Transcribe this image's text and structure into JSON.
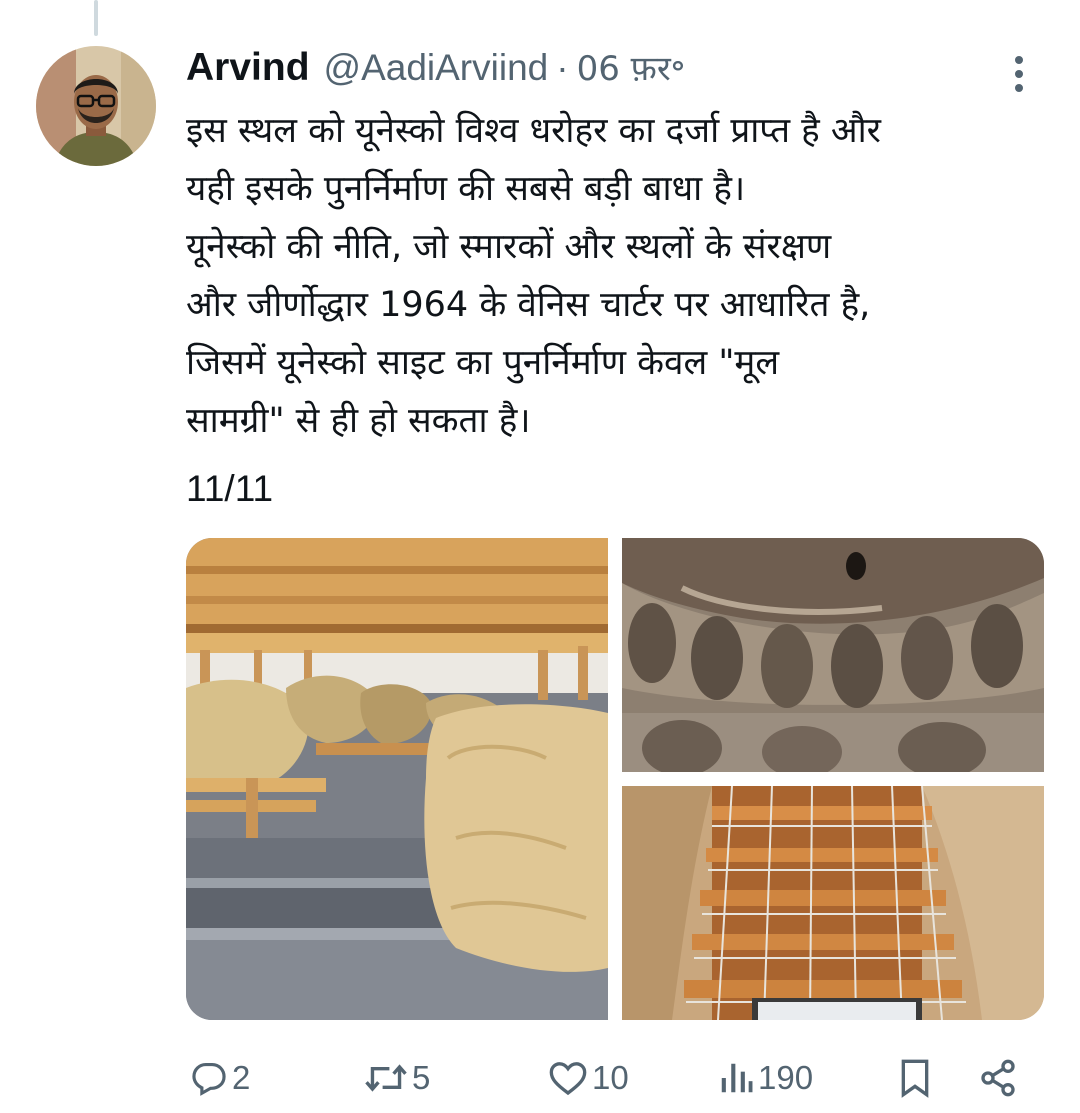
{
  "tweet": {
    "author_name": "Arvind",
    "author_handle": "@AadiArviind",
    "separator": "·",
    "date": "06 फ़र॰",
    "text": "इस स्थल को यूनेस्को विश्व धरोहर का दर्जा प्राप्त है और\nयही इसके पुनर्निर्माण की सबसे बड़ी बाधा है।\nयूनेस्को की नीति, जो स्मारकों और स्थलों के संरक्षण\nऔर जीर्णोद्धार 1964 के वेनिस चार्टर पर आधारित है,\nजिसमें यूनेस्को साइट का पुनर्निर्माण केवल \"मूल\nसामग्री\" से ही हो सकता है।",
    "thread_counter": "11/11"
  },
  "media": [
    {
      "icon": "photo-rock-fragments-under-wooden-shelter"
    },
    {
      "icon": "photo-carved-niches-dome"
    },
    {
      "icon": "photo-scaffolding-in-niche"
    }
  ],
  "actions": {
    "replies": "2",
    "reposts": "5",
    "likes": "10",
    "views": "190"
  },
  "icons": {
    "more": "more-vertical-icon",
    "reply": "reply-icon",
    "repost": "repost-icon",
    "like": "heart-icon",
    "views": "views-icon",
    "bookmark": "bookmark-icon",
    "share": "share-icon"
  },
  "colors": {
    "text": "#0f1419",
    "secondary": "#536471",
    "thread_line": "#cfd9de"
  }
}
